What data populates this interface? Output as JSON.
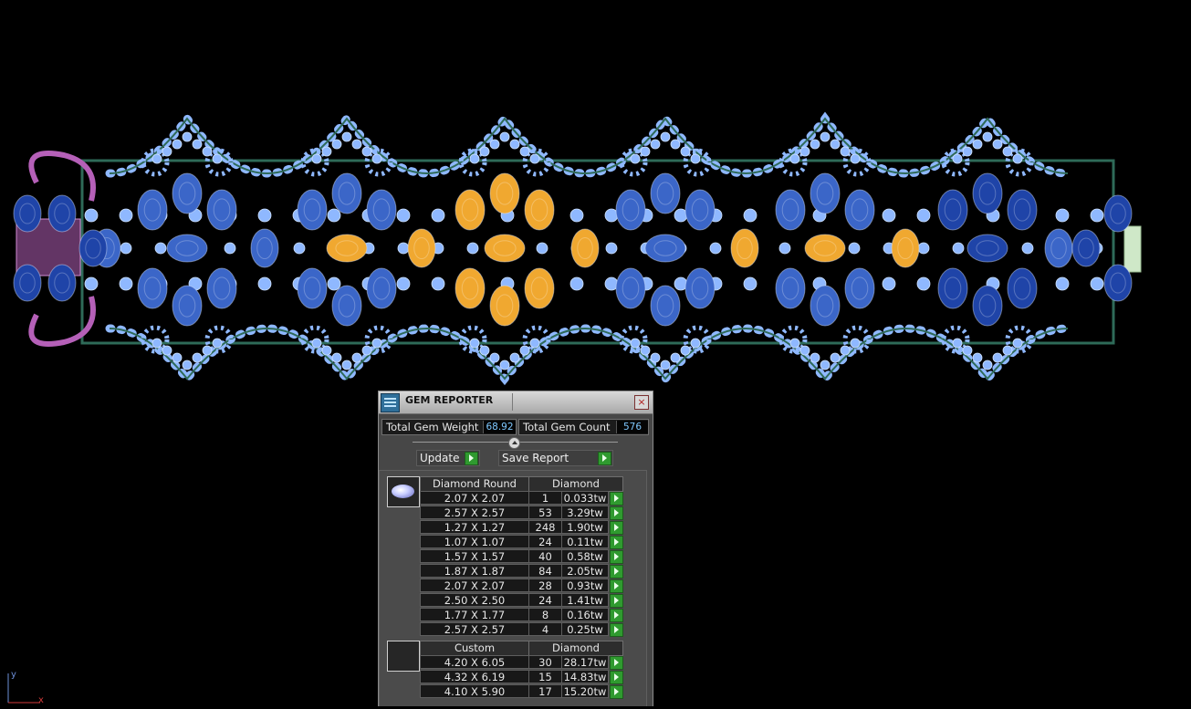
{
  "viewport": {
    "axis": {
      "y_label": "y",
      "x_label": "x"
    },
    "colors": {
      "background": "#000000",
      "diamond": "#8fb8ff",
      "sapphire": "#3b66c8",
      "citrine": "#f0a830",
      "amethyst": "#b560b8",
      "metal": "#2e6a58"
    }
  },
  "gem_reporter": {
    "title": "GEM REPORTER",
    "close_icon": "close-icon",
    "total_gem_weight_label": "Total Gem Weight",
    "total_gem_weight_value": "68.92",
    "total_gem_count_label": "Total Gem Count",
    "total_gem_count_value": "576",
    "update_label": "Update",
    "save_report_label": "Save Report",
    "groups": [
      {
        "shape": "Diamond Round",
        "material": "Diamond",
        "thumb_icon": "round-gem-icon",
        "rows": [
          {
            "size": "2.07 X 2.07",
            "count": "1",
            "weight": "0.033tw"
          },
          {
            "size": "2.57 X 2.57",
            "count": "53",
            "weight": "3.29tw"
          },
          {
            "size": "1.27 X 1.27",
            "count": "248",
            "weight": "1.90tw"
          },
          {
            "size": "1.07 X 1.07",
            "count": "24",
            "weight": "0.11tw"
          },
          {
            "size": "1.57 X 1.57",
            "count": "40",
            "weight": "0.58tw"
          },
          {
            "size": "1.87 X 1.87",
            "count": "84",
            "weight": "2.05tw"
          },
          {
            "size": "2.07 X 2.07",
            "count": "28",
            "weight": "0.93tw"
          },
          {
            "size": "2.50 X 2.50",
            "count": "24",
            "weight": "1.41tw"
          },
          {
            "size": "1.77 X 1.77",
            "count": "8",
            "weight": "0.16tw"
          },
          {
            "size": "2.57 X 2.57",
            "count": "4",
            "weight": "0.25tw"
          }
        ]
      },
      {
        "shape": "Custom",
        "material": "Diamond",
        "thumb_icon": "blank-thumbnail",
        "rows": [
          {
            "size": "4.20 X 6.05",
            "count": "30",
            "weight": "28.17tw"
          },
          {
            "size": "4.32 X 6.19",
            "count": "15",
            "weight": "14.83tw"
          },
          {
            "size": "4.10 X 5.90",
            "count": "17",
            "weight": "15.20tw"
          }
        ]
      }
    ]
  }
}
